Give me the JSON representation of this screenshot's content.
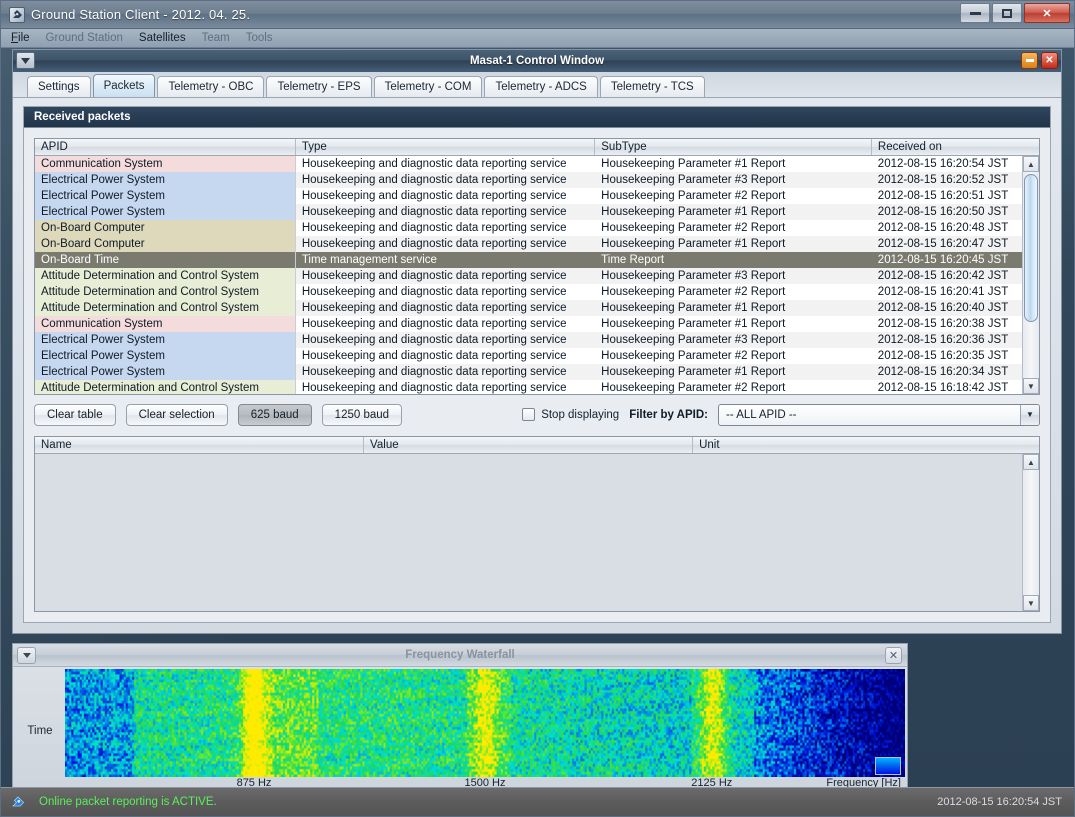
{
  "window": {
    "title": "Ground Station Client - 2012. 04. 25.",
    "icon": "satellite-icon",
    "minimize_label": "—",
    "maximize_label": "□",
    "close_label": "✕"
  },
  "menubar": {
    "items": [
      {
        "label": "File",
        "enabled": true
      },
      {
        "label": "Ground Station",
        "enabled": false
      },
      {
        "label": "Satellites",
        "enabled": true
      },
      {
        "label": "Team",
        "enabled": false
      },
      {
        "label": "Tools",
        "enabled": false
      }
    ]
  },
  "internal_window": {
    "title": "Masat-1 Control Window",
    "menu_glyph": "▼",
    "minimize_label": "—",
    "close_label": "✕"
  },
  "tabs": [
    {
      "label": "Settings",
      "active": false
    },
    {
      "label": "Packets",
      "active": true
    },
    {
      "label": "Telemetry - OBC",
      "active": false
    },
    {
      "label": "Telemetry - EPS",
      "active": false
    },
    {
      "label": "Telemetry - COM",
      "active": false
    },
    {
      "label": "Telemetry - ADCS",
      "active": false
    },
    {
      "label": "Telemetry - TCS",
      "active": false
    }
  ],
  "panel": {
    "title": "Received packets"
  },
  "packets_table": {
    "columns": [
      "APID",
      "Type",
      "SubType",
      "Received on"
    ],
    "rows": [
      {
        "apid": "Communication System",
        "type": "Housekeeping and diagnostic data reporting service",
        "subtype": "Housekeeping Parameter #1 Report",
        "received": "2012-08-15 16:20:54 JST",
        "color": "#f4dcdc",
        "selected": false
      },
      {
        "apid": "Electrical Power System",
        "type": "Housekeeping and diagnostic data reporting service",
        "subtype": "Housekeeping Parameter #3 Report",
        "received": "2012-08-15 16:20:52 JST",
        "color": "#c6d8ef",
        "selected": false
      },
      {
        "apid": "Electrical Power System",
        "type": "Housekeeping and diagnostic data reporting service",
        "subtype": "Housekeeping Parameter #2 Report",
        "received": "2012-08-15 16:20:51 JST",
        "color": "#c6d8ef",
        "selected": false
      },
      {
        "apid": "Electrical Power System",
        "type": "Housekeeping and diagnostic data reporting service",
        "subtype": "Housekeeping Parameter #1 Report",
        "received": "2012-08-15 16:20:50 JST",
        "color": "#c6d8ef",
        "selected": false
      },
      {
        "apid": "On-Board Computer",
        "type": "Housekeeping and diagnostic data reporting service",
        "subtype": "Housekeeping Parameter #2 Report",
        "received": "2012-08-15 16:20:48 JST",
        "color": "#ded9bb",
        "selected": false
      },
      {
        "apid": "On-Board Computer",
        "type": "Housekeeping and diagnostic data reporting service",
        "subtype": "Housekeeping Parameter #1 Report",
        "received": "2012-08-15 16:20:47 JST",
        "color": "#ded9bb",
        "selected": false
      },
      {
        "apid": "On-Board Time",
        "type": "Time management service",
        "subtype": "Time Report",
        "received": "2012-08-15 16:20:45 JST",
        "color": "#7a7a6e",
        "selected": true
      },
      {
        "apid": "Attitude Determination and Control System",
        "type": "Housekeeping and diagnostic data reporting service",
        "subtype": "Housekeeping Parameter #3 Report",
        "received": "2012-08-15 16:20:42 JST",
        "color": "#e8edd5",
        "selected": false
      },
      {
        "apid": "Attitude Determination and Control System",
        "type": "Housekeeping and diagnostic data reporting service",
        "subtype": "Housekeeping Parameter #2 Report",
        "received": "2012-08-15 16:20:41 JST",
        "color": "#e8edd5",
        "selected": false
      },
      {
        "apid": "Attitude Determination and Control System",
        "type": "Housekeeping and diagnostic data reporting service",
        "subtype": "Housekeeping Parameter #1 Report",
        "received": "2012-08-15 16:20:40 JST",
        "color": "#e8edd5",
        "selected": false
      },
      {
        "apid": "Communication System",
        "type": "Housekeeping and diagnostic data reporting service",
        "subtype": "Housekeeping Parameter #1 Report",
        "received": "2012-08-15 16:20:38 JST",
        "color": "#f4dcdc",
        "selected": false
      },
      {
        "apid": "Electrical Power System",
        "type": "Housekeeping and diagnostic data reporting service",
        "subtype": "Housekeeping Parameter #3 Report",
        "received": "2012-08-15 16:20:36 JST",
        "color": "#c6d8ef",
        "selected": false
      },
      {
        "apid": "Electrical Power System",
        "type": "Housekeeping and diagnostic data reporting service",
        "subtype": "Housekeeping Parameter #2 Report",
        "received": "2012-08-15 16:20:35 JST",
        "color": "#c6d8ef",
        "selected": false
      },
      {
        "apid": "Electrical Power System",
        "type": "Housekeeping and diagnostic data reporting service",
        "subtype": "Housekeeping Parameter #1 Report",
        "received": "2012-08-15 16:20:34 JST",
        "color": "#c6d8ef",
        "selected": false
      },
      {
        "apid": "Attitude Determination and Control System",
        "type": "Housekeeping and diagnostic data reporting service",
        "subtype": "Housekeeping Parameter #2 Report",
        "received": "2012-08-15 16:18:42 JST",
        "color": "#e8edd5",
        "selected": false
      }
    ]
  },
  "controls": {
    "clear_table": "Clear table",
    "clear_selection": "Clear selection",
    "baud_625": "625 baud",
    "baud_1250": "1250 baud",
    "baud_625_pressed": true,
    "stop_displaying_label": "Stop displaying",
    "stop_displaying_checked": false,
    "filter_label": "Filter by APID:",
    "filter_value": "-- ALL APID --",
    "filter_arrow": "▼"
  },
  "detail_table": {
    "columns": [
      "Name",
      "Value",
      "Unit"
    ],
    "rows": []
  },
  "waterfall": {
    "title": "Frequency Waterfall",
    "menu_glyph": "▼",
    "close_label": "✕",
    "y_axis_label": "Time",
    "x_axis_label": "Frequency [Hz]",
    "x_ticks": [
      "875 Hz",
      "1500 Hz",
      "2125 Hz"
    ],
    "legend_name": "colorbar-swatch"
  },
  "statusbar": {
    "icon": "satellite-icon",
    "message": "Online packet reporting is ACTIVE.",
    "timestamp": "2012-08-15 16:20:54 JST",
    "message_color": "#5bf05b"
  }
}
